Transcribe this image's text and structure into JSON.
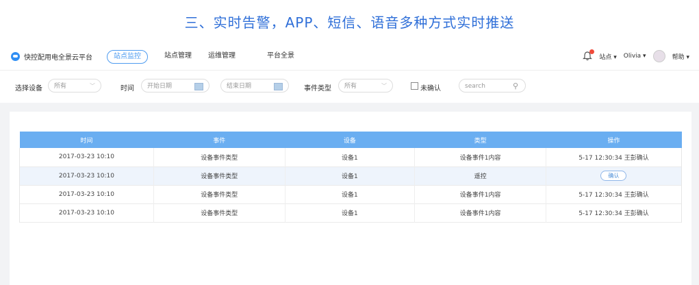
{
  "banner": {
    "title": "三、实时告警，APP、短信、语音多种方式实时推送"
  },
  "navbar": {
    "brand": "快控配用电全景云平台",
    "tabs": [
      "站点监控",
      "站点管理",
      "运维管理",
      "平台全景"
    ],
    "active_tab": "站点监控",
    "right": {
      "site": "站点",
      "user": "Olivia",
      "help": "帮助"
    }
  },
  "filters": {
    "device_label": "选择设备",
    "device_value": "所有",
    "time_label": "时间",
    "start_placeholder": "开始日期",
    "end_placeholder": "结束日期",
    "event_type_label": "事件类型",
    "event_type_value": "所有",
    "unconfirmed_label": "未确认",
    "search_placeholder": "search"
  },
  "table": {
    "headers": [
      "时间",
      "事件",
      "设备",
      "类型",
      "操作"
    ],
    "rows": [
      {
        "time": "2017-03-23 10:10",
        "event": "设备事件类型",
        "device": "设备1",
        "type": "设备事件1内容",
        "op": "5-17 12:30:34 王彭确认"
      },
      {
        "time": "2017-03-23 10:10",
        "event": "设备事件类型",
        "device": "设备1",
        "type": "遥控",
        "op": "确认"
      },
      {
        "time": "2017-03-23 10:10",
        "event": "设备事件类型",
        "device": "设备1",
        "type": "设备事件1内容",
        "op": "5-17 12:30:34 王彭确认"
      },
      {
        "time": "2017-03-23 10:10",
        "event": "设备事件类型",
        "device": "设备1",
        "type": "设备事件1内容",
        "op": "5-17 12:30:34 王彭确认"
      }
    ]
  },
  "colors": {
    "accent": "#2f6fd8",
    "table_header": "#6aaef1",
    "badge": "#f04a3a"
  }
}
